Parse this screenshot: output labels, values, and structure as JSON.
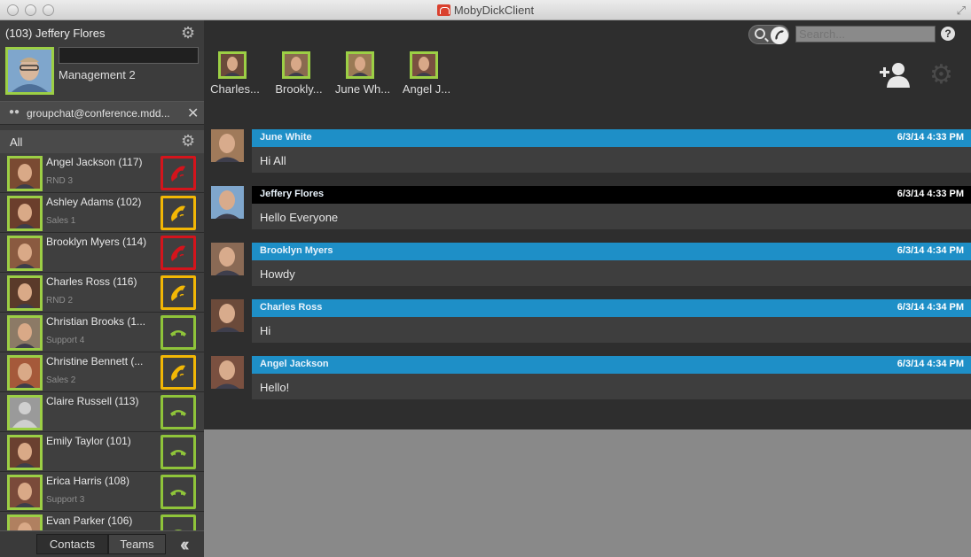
{
  "window": {
    "title": "MobyDickClient"
  },
  "me": {
    "name": "(103) Jeffery Flores",
    "status_value": "",
    "group": "Management 2"
  },
  "groupchat": {
    "label": "groupchat@conference.mdd..."
  },
  "filter": {
    "label": "All"
  },
  "contacts": [
    {
      "name": "Angel Jackson (117)",
      "group": "RND 3",
      "phone_status": "busy"
    },
    {
      "name": "Ashley Adams (102)",
      "group": "Sales 1",
      "phone_status": "ringing"
    },
    {
      "name": "Brooklyn Myers (114)",
      "group": "",
      "phone_status": "busy"
    },
    {
      "name": "Charles Ross (116)",
      "group": "RND 2",
      "phone_status": "ringing"
    },
    {
      "name": "Christian Brooks (1...",
      "group": "Support 4",
      "phone_status": "available"
    },
    {
      "name": "Christine Bennett (...",
      "group": "Sales 2",
      "phone_status": "ringing"
    },
    {
      "name": "Claire Russell (113)",
      "group": "",
      "phone_status": "available"
    },
    {
      "name": "Emily Taylor (101)",
      "group": "",
      "phone_status": "available"
    },
    {
      "name": "Erica Harris (108)",
      "group": "Support 3",
      "phone_status": "available"
    },
    {
      "name": "Evan Parker (106)",
      "group": "",
      "phone_status": "available"
    }
  ],
  "bottom_tabs": {
    "contacts": "Contacts",
    "teams": "Teams"
  },
  "search": {
    "placeholder": "Search..."
  },
  "help": {
    "label": "?"
  },
  "participants": [
    {
      "name": "Charles..."
    },
    {
      "name": "Brookly..."
    },
    {
      "name": "June Wh..."
    },
    {
      "name": "Angel J..."
    }
  ],
  "messages": [
    {
      "sender": "June White",
      "time": "6/3/14 4:33 PM",
      "text": "Hi All",
      "self": false
    },
    {
      "sender": "Jeffery Flores",
      "time": "6/3/14 4:33 PM",
      "text": "Hello Everyone",
      "self": true
    },
    {
      "sender": "Brooklyn Myers",
      "time": "6/3/14 4:34 PM",
      "text": "Howdy",
      "self": false
    },
    {
      "sender": "Charles Ross",
      "time": "6/3/14 4:34 PM",
      "text": "Hi",
      "self": false
    },
    {
      "sender": "Angel Jackson",
      "time": "6/3/14 4:34 PM",
      "text": "Hello!",
      "self": false
    }
  ],
  "colors": {
    "busy": "#d4141c",
    "ringing": "#f2b705",
    "available": "#8fc43a",
    "accent": "#1e8fc7",
    "self_header": "#000000"
  },
  "icons": {
    "settings": "gear-icon",
    "close": "close-icon",
    "add_user": "add-user-icon",
    "phone": "phone-icon",
    "search": "search-icon",
    "collapse": "double-chevron-left-icon"
  }
}
